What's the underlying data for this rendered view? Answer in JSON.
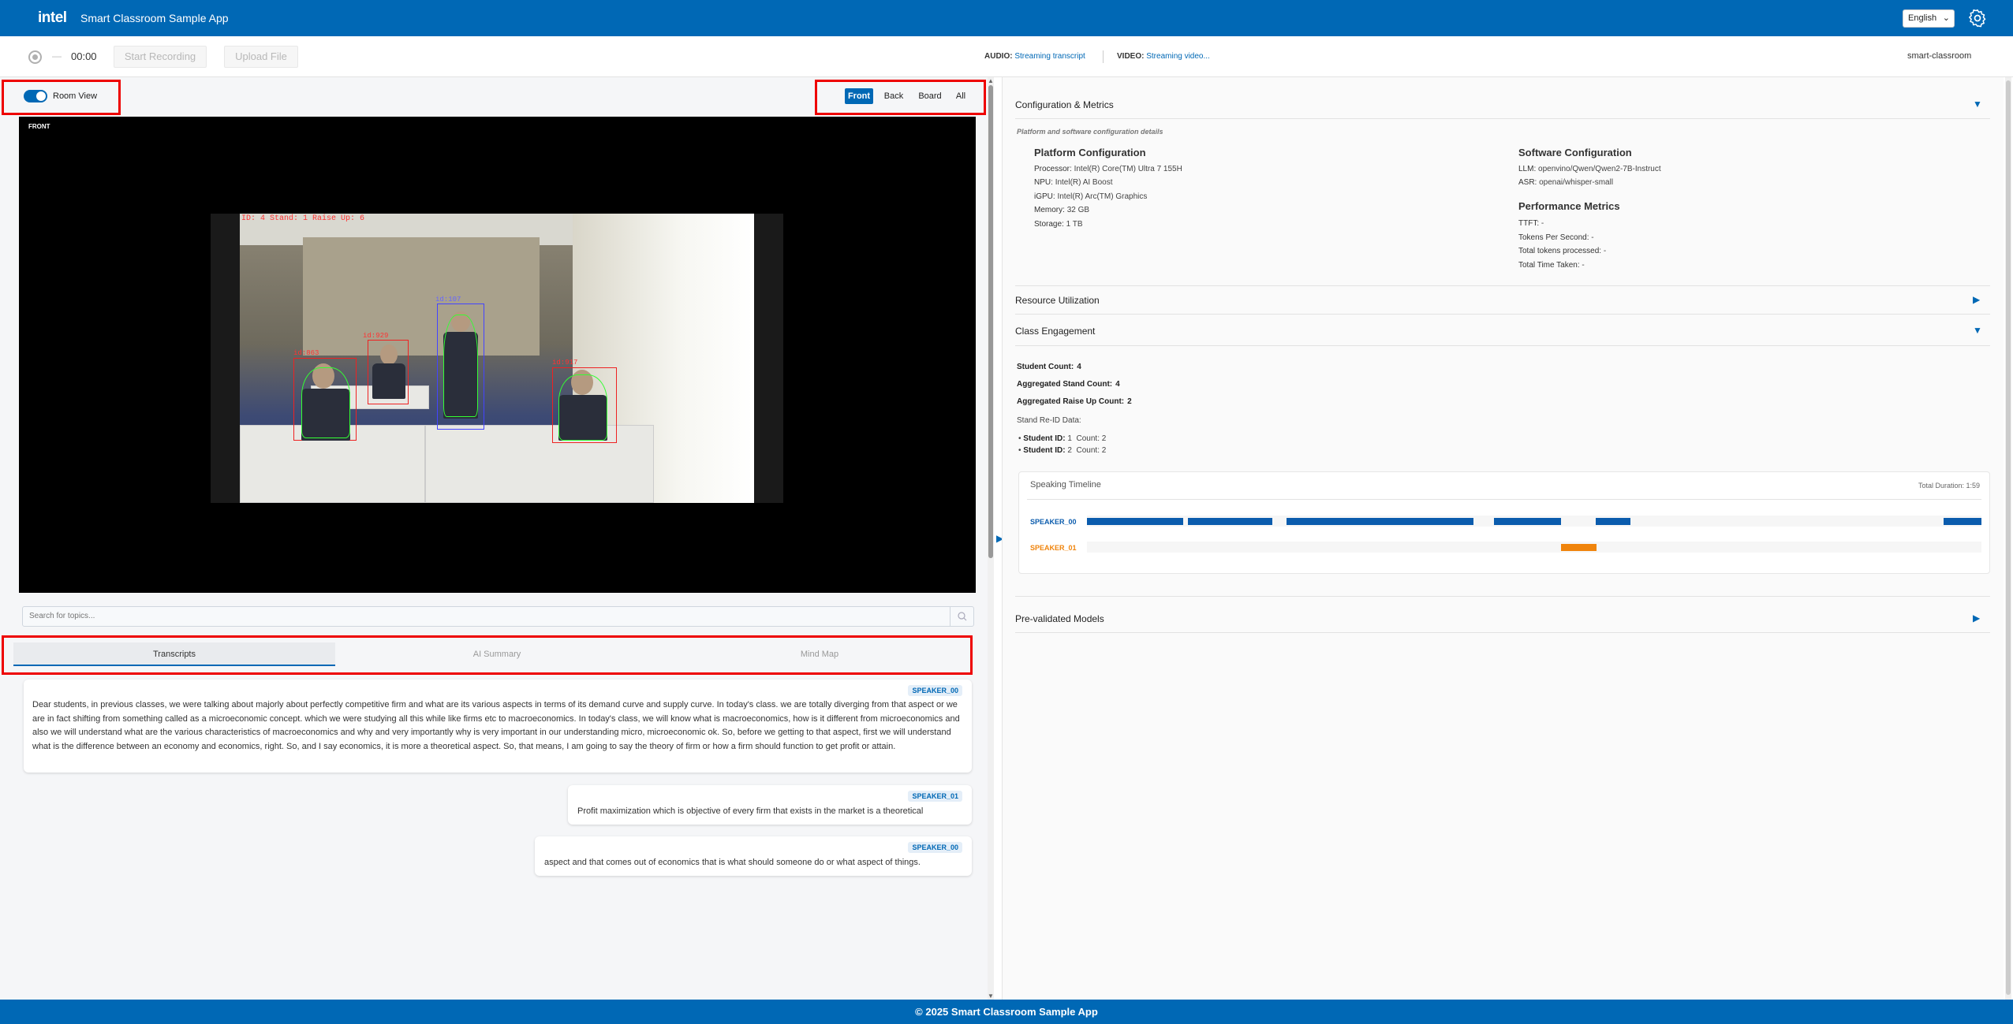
{
  "header": {
    "logo": "intel",
    "title": "Smart Classroom Sample App",
    "language": "English",
    "settings_icon": "gear-icon"
  },
  "toolbar": {
    "timer": "00:00",
    "dash": "—",
    "start_recording": "Start Recording",
    "upload_file": "Upload File",
    "audio_label": "AUDIO:",
    "audio_value": "Streaming transcript",
    "video_label": "VIDEO:",
    "video_value": "Streaming video...",
    "project": "smart-classroom"
  },
  "room": {
    "toggle_label": "Room View",
    "toggle_on": true,
    "views": [
      "Front",
      "Back",
      "Board",
      "All"
    ],
    "active_view": "Front",
    "video_label": "FRONT",
    "overlay_text": "ID: 4  Stand: 1  Raise Up: 6",
    "person_labels": [
      "id:863",
      "id:929",
      "id:107",
      "id:917"
    ]
  },
  "search": {
    "placeholder": "Search for topics..."
  },
  "tabs": [
    "Transcripts",
    "AI Summary",
    "Mind Map"
  ],
  "active_tab": "Transcripts",
  "transcripts": [
    {
      "speaker": "SPEAKER_00",
      "text": "Dear students, in previous classes, we were talking about majorly about perfectly competitive firm and what are its various aspects in terms of its demand curve and supply curve. In today's class. we are totally diverging from that aspect or we are in fact shifting from something called as a microeconomic concept. which we were studying all this while like firms etc to macroeconomics. In today's class, we will know what is macroeconomics, how is it different from microeconomics and also we will understand what are the various characteristics of macroeconomics and why and very importantly why is very important in our understanding micro, microeconomic ok. So, before we getting to that aspect, first we will understand what is the difference between an economy and economics, right. So, and I say economics, it is more a theoretical aspect. So, that means, I am going to say the theory of firm or how a firm should function to get profit or attain."
    },
    {
      "speaker": "SPEAKER_01",
      "text": "Profit maximization which is objective of every firm that exists in the market is a theoretical"
    },
    {
      "speaker": "SPEAKER_00",
      "text": "aspect and that comes out of economics that is what should someone do or what aspect of things."
    }
  ],
  "config": {
    "title": "Configuration & Metrics",
    "subtitle": "Platform and software configuration details",
    "platform_title": "Platform Configuration",
    "platform": [
      {
        "k": "Processor:",
        "v": "Intel(R) Core(TM) Ultra 7 155H"
      },
      {
        "k": "NPU:",
        "v": "Intel(R) AI Boost"
      },
      {
        "k": "iGPU:",
        "v": "Intel(R) Arc(TM) Graphics"
      },
      {
        "k": "Memory:",
        "v": "32 GB"
      },
      {
        "k": "Storage:",
        "v": "1 TB"
      }
    ],
    "software_title": "Software Configuration",
    "software": [
      {
        "k": "LLM:",
        "v": "openvino/Qwen/Qwen2-7B-Instruct"
      },
      {
        "k": "ASR:",
        "v": "openai/whisper-small"
      }
    ],
    "perf_title": "Performance Metrics",
    "perf": [
      {
        "k": "TTFT:",
        "v": "-"
      },
      {
        "k": "Tokens Per Second:",
        "v": "-"
      },
      {
        "k": "Total tokens processed:",
        "v": "-"
      },
      {
        "k": "Total Time Taken:",
        "v": "-"
      }
    ]
  },
  "resource": {
    "title": "Resource Utilization"
  },
  "engagement": {
    "title": "Class Engagement",
    "student_count_label": "Student Count:",
    "student_count": "4",
    "stand_label": "Aggregated Stand Count:",
    "stand_count": "4",
    "raise_label": "Aggregated Raise Up Count:",
    "raise_count": "2",
    "reid_label": "Stand Re-ID Data:",
    "reid": [
      {
        "label": "Student ID:",
        "id": "1",
        "count_label": "Count:",
        "count": "2"
      },
      {
        "label": "Student ID:",
        "id": "2",
        "count_label": "Count:",
        "count": "2"
      }
    ]
  },
  "timeline": {
    "title": "Speaking Timeline",
    "duration_label": "Total Duration: 1:59",
    "speakers": [
      {
        "name": "SPEAKER_00",
        "color": "#0b5cad",
        "segments": [
          [
            0,
            0.108
          ],
          [
            0.113,
            0.207
          ],
          [
            0.223,
            0.432
          ],
          [
            0.455,
            0.53
          ],
          [
            0.569,
            0.608
          ],
          [
            0.958,
            1.0
          ]
        ]
      },
      {
        "name": "SPEAKER_01",
        "color": "#f0840c",
        "segments": [
          [
            0.53,
            0.57
          ]
        ]
      }
    ]
  },
  "models": {
    "title": "Pre-validated Models"
  },
  "footer": {
    "text": "© 2025 Smart Classroom Sample App"
  },
  "colors": {
    "brand": "#0068b5",
    "highlight": "#e00000"
  }
}
